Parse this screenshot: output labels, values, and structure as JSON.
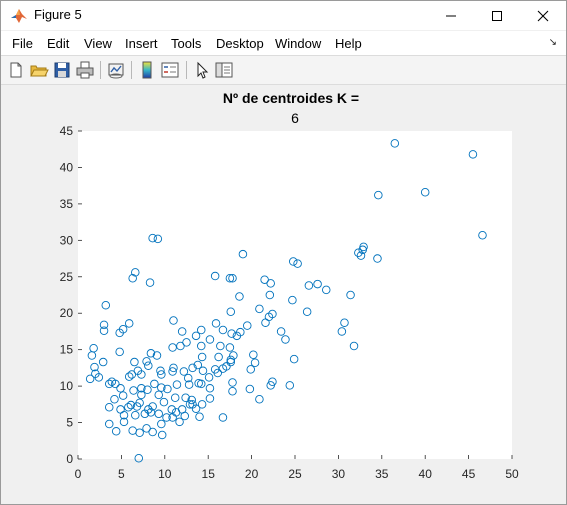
{
  "window": {
    "title": "Figure 5",
    "controls": {
      "minimize": "minimize",
      "maximize": "maximize",
      "close": "close"
    }
  },
  "menu": {
    "items": [
      "File",
      "Edit",
      "View",
      "Insert",
      "Tools",
      "Desktop",
      "Window",
      "Help"
    ]
  },
  "toolbar": {
    "buttons": [
      "new-figure-icon",
      "open-file-icon",
      "save-icon",
      "print-icon",
      "link-plot-icon",
      "colorbar-icon",
      "legend-icon",
      "pointer-icon",
      "property-editor-icon"
    ]
  },
  "colors": {
    "marker": "#0072BD",
    "window_bg": "#f0f0f0",
    "axes_bg": "#ffffff"
  },
  "chart_data": {
    "type": "scatter",
    "title": "Nº de centroides K =",
    "subtitle": "6",
    "xlabel": "",
    "ylabel": "",
    "xlim": [
      0,
      50
    ],
    "ylim": [
      0,
      45
    ],
    "xticks": [
      0,
      5,
      10,
      15,
      20,
      25,
      30,
      35,
      40,
      45,
      50
    ],
    "yticks": [
      0,
      5,
      10,
      15,
      20,
      25,
      30,
      35,
      40,
      45
    ],
    "marker": "circle-open",
    "grid": false,
    "points": [
      [
        36.5,
        43.3
      ],
      [
        45.5,
        41.8
      ],
      [
        40,
        36.6
      ],
      [
        34.6,
        36.2
      ],
      [
        46.6,
        30.7
      ],
      [
        8.6,
        30.3
      ],
      [
        9.2,
        30.2
      ],
      [
        19,
        28.1
      ],
      [
        32.3,
        28.3
      ],
      [
        32.8,
        28.7
      ],
      [
        32.9,
        29.1
      ],
      [
        32.6,
        27.9
      ],
      [
        34.5,
        27.5
      ],
      [
        24.8,
        27.1
      ],
      [
        25.3,
        26.8
      ],
      [
        6.6,
        25.6
      ],
      [
        6.3,
        24.8
      ],
      [
        15.8,
        25.1
      ],
      [
        17.5,
        24.8
      ],
      [
        17.8,
        24.8
      ],
      [
        21.5,
        24.6
      ],
      [
        8.3,
        24.2
      ],
      [
        26.6,
        23.8
      ],
      [
        27.6,
        24
      ],
      [
        22.2,
        24.1
      ],
      [
        28.6,
        23.2
      ],
      [
        22.1,
        22.5
      ],
      [
        18.6,
        22.3
      ],
      [
        31.4,
        22.5
      ],
      [
        24.7,
        21.8
      ],
      [
        3.2,
        21.1
      ],
      [
        20.9,
        20.6
      ],
      [
        17.6,
        20.2
      ],
      [
        26.4,
        20.2
      ],
      [
        22.4,
        19.9
      ],
      [
        22,
        19.5
      ],
      [
        11,
        19
      ],
      [
        19.5,
        18.3
      ],
      [
        3,
        18.4
      ],
      [
        5.9,
        18.6
      ],
      [
        5.2,
        17.8
      ],
      [
        3,
        17.6
      ],
      [
        4.8,
        17.3
      ],
      [
        15.9,
        18.6
      ],
      [
        14.2,
        17.7
      ],
      [
        18.7,
        17.4
      ],
      [
        21.6,
        18.7
      ],
      [
        30.7,
        18.7
      ],
      [
        30.4,
        17.5
      ],
      [
        23.4,
        17.5
      ],
      [
        12,
        17.5
      ],
      [
        16.7,
        17.7
      ],
      [
        17.7,
        17.2
      ],
      [
        13.6,
        16.9
      ],
      [
        15.2,
        16.4
      ],
      [
        18.3,
        16.9
      ],
      [
        23.9,
        16.4
      ],
      [
        12.5,
        16
      ],
      [
        11.8,
        15.5
      ],
      [
        14.2,
        15.5
      ],
      [
        16.4,
        15.5
      ],
      [
        10.9,
        15.3
      ],
      [
        17.5,
        15.3
      ],
      [
        31.8,
        15.5
      ],
      [
        1.8,
        15.2
      ],
      [
        4.8,
        14.7
      ],
      [
        8.4,
        14.5
      ],
      [
        1.6,
        14.2
      ],
      [
        9.1,
        14.2
      ],
      [
        17.9,
        14.2
      ],
      [
        20.2,
        14.3
      ],
      [
        14.3,
        14
      ],
      [
        16.2,
        14
      ],
      [
        24.9,
        13.7
      ],
      [
        17.6,
        13.6
      ],
      [
        17.6,
        13.3
      ],
      [
        20.4,
        13.2
      ],
      [
        2.9,
        13.3
      ],
      [
        6.5,
        13.3
      ],
      [
        7.9,
        13.4
      ],
      [
        1.9,
        12.6
      ],
      [
        8.1,
        12.8
      ],
      [
        11,
        12.5
      ],
      [
        13.2,
        12.5
      ],
      [
        13.8,
        12.9
      ],
      [
        17.1,
        12.7
      ],
      [
        6.9,
        12.1
      ],
      [
        9.5,
        12.1
      ],
      [
        10.9,
        12
      ],
      [
        12.2,
        12
      ],
      [
        14.4,
        12.1
      ],
      [
        15.8,
        12.3
      ],
      [
        16.7,
        12.4
      ],
      [
        19.9,
        12.3
      ],
      [
        2,
        11.7
      ],
      [
        6.2,
        11.6
      ],
      [
        7.3,
        11.6
      ],
      [
        9.6,
        11.6
      ],
      [
        16.1,
        11.8
      ],
      [
        1.4,
        11
      ],
      [
        2.4,
        11.2
      ],
      [
        5.9,
        11.3
      ],
      [
        12.7,
        11.1
      ],
      [
        15.1,
        11.2
      ],
      [
        3.9,
        10.6
      ],
      [
        13.9,
        10.4
      ],
      [
        22.4,
        10.6
      ],
      [
        4.3,
        10.3
      ],
      [
        8.8,
        10.3
      ],
      [
        11.4,
        10.2
      ],
      [
        12.8,
        10.2
      ],
      [
        14.2,
        10.3
      ],
      [
        17.8,
        10.5
      ],
      [
        24.4,
        10.1
      ],
      [
        3.6,
        10.3
      ],
      [
        22.2,
        10.1
      ],
      [
        4.9,
        9.7
      ],
      [
        7.3,
        9.7
      ],
      [
        9.6,
        9.8
      ],
      [
        10.3,
        9.6
      ],
      [
        15.2,
        9.7
      ],
      [
        19.8,
        9.6
      ],
      [
        8,
        9.5
      ],
      [
        6.4,
        9.4
      ],
      [
        17.8,
        9.3
      ],
      [
        5.2,
        8.7
      ],
      [
        7.3,
        8.8
      ],
      [
        9.3,
        8.8
      ],
      [
        11.2,
        8.4
      ],
      [
        12.4,
        8.4
      ],
      [
        15.2,
        8.3
      ],
      [
        4.2,
        8.2
      ],
      [
        13.1,
        8.1
      ],
      [
        20.9,
        8.2
      ],
      [
        7.1,
        7.7
      ],
      [
        9.9,
        7.8
      ],
      [
        13.2,
        7.5
      ],
      [
        14.3,
        7.5
      ],
      [
        6.1,
        7.4
      ],
      [
        8.6,
        7.2
      ],
      [
        12.9,
        7.5
      ],
      [
        3.6,
        7.1
      ],
      [
        5.8,
        7.1
      ],
      [
        6.8,
        7.2
      ],
      [
        4.9,
        6.8
      ],
      [
        8.1,
        6.8
      ],
      [
        10.8,
        6.8
      ],
      [
        12,
        6.8
      ],
      [
        13.6,
        6.9
      ],
      [
        8.4,
        6.4
      ],
      [
        11.3,
        6.4
      ],
      [
        5.3,
        6
      ],
      [
        6.6,
        6
      ],
      [
        9.3,
        6.2
      ],
      [
        7.7,
        6.2
      ],
      [
        12.3,
        5.9
      ],
      [
        14,
        5.8
      ],
      [
        10.2,
        5.7
      ],
      [
        10.9,
        5.7
      ],
      [
        16.7,
        5.7
      ],
      [
        5.3,
        5.1
      ],
      [
        11.7,
        5.1
      ],
      [
        3.6,
        4.8
      ],
      [
        9.6,
        4.8
      ],
      [
        7.9,
        4.2
      ],
      [
        4.4,
        3.8
      ],
      [
        8.6,
        3.7
      ],
      [
        7.1,
        3.6
      ],
      [
        6.3,
        3.9
      ],
      [
        9.7,
        3.3
      ],
      [
        7,
        0.1
      ]
    ]
  }
}
